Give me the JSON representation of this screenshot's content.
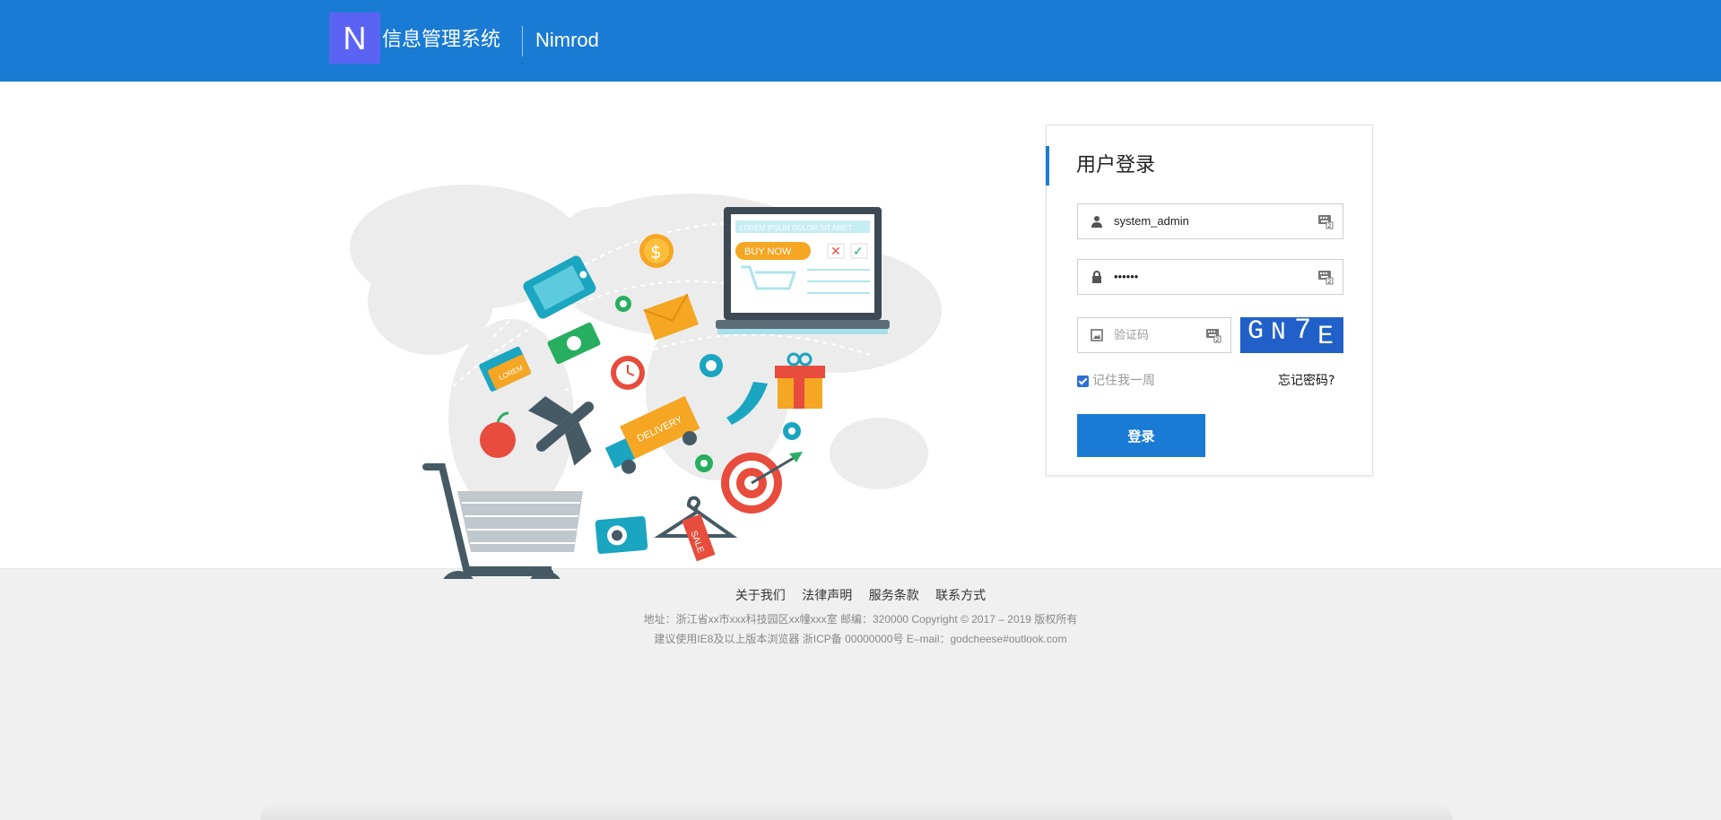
{
  "header": {
    "logo_letter": "N",
    "system_title": "信息管理系统",
    "brand": "Nimrod"
  },
  "illustration": {
    "laptop_banner": "LOREM IPSUM DOLOR SIT AMET",
    "buy_now": "BUY NOW",
    "delivery": "DELIVERY",
    "sale": "SALE",
    "card_text": "LOREM",
    "colors": {
      "map": "#e9e9e9",
      "teal": "#1aa5c0",
      "orange": "#f5a623",
      "red": "#e74c3c",
      "green": "#27ae60",
      "dark": "#455a64"
    }
  },
  "login": {
    "title": "用户登录",
    "username_value": "system_admin",
    "password_value": "••••••",
    "captcha_placeholder": "验证码",
    "captcha_text": [
      "G",
      "N",
      "7",
      "E"
    ],
    "remember_label": "记住我一周",
    "forgot_label": "忘记密码?",
    "submit_label": "登录",
    "icons": [
      "user-icon",
      "lock-icon",
      "image-icon",
      "keyboard-icon"
    ]
  },
  "footer": {
    "links": [
      "关于我们",
      "法律声明",
      "服务条款",
      "联系方式"
    ],
    "address_line": "地址：浙江省xx市xxx科技园区xx幢xxx室 邮编：320000  Copyright © 2017 – 2019  版权所有",
    "browser_line": "建议使用IE8及以上版本浏览器 浙ICP备 00000000号 E–mail：godcheese#outlook.com"
  },
  "colors": {
    "primary": "#1a7bd4",
    "logo_bg": "#5b63f5",
    "captcha_bg": "#2060c8",
    "footer_bg": "#f0f0f0"
  }
}
